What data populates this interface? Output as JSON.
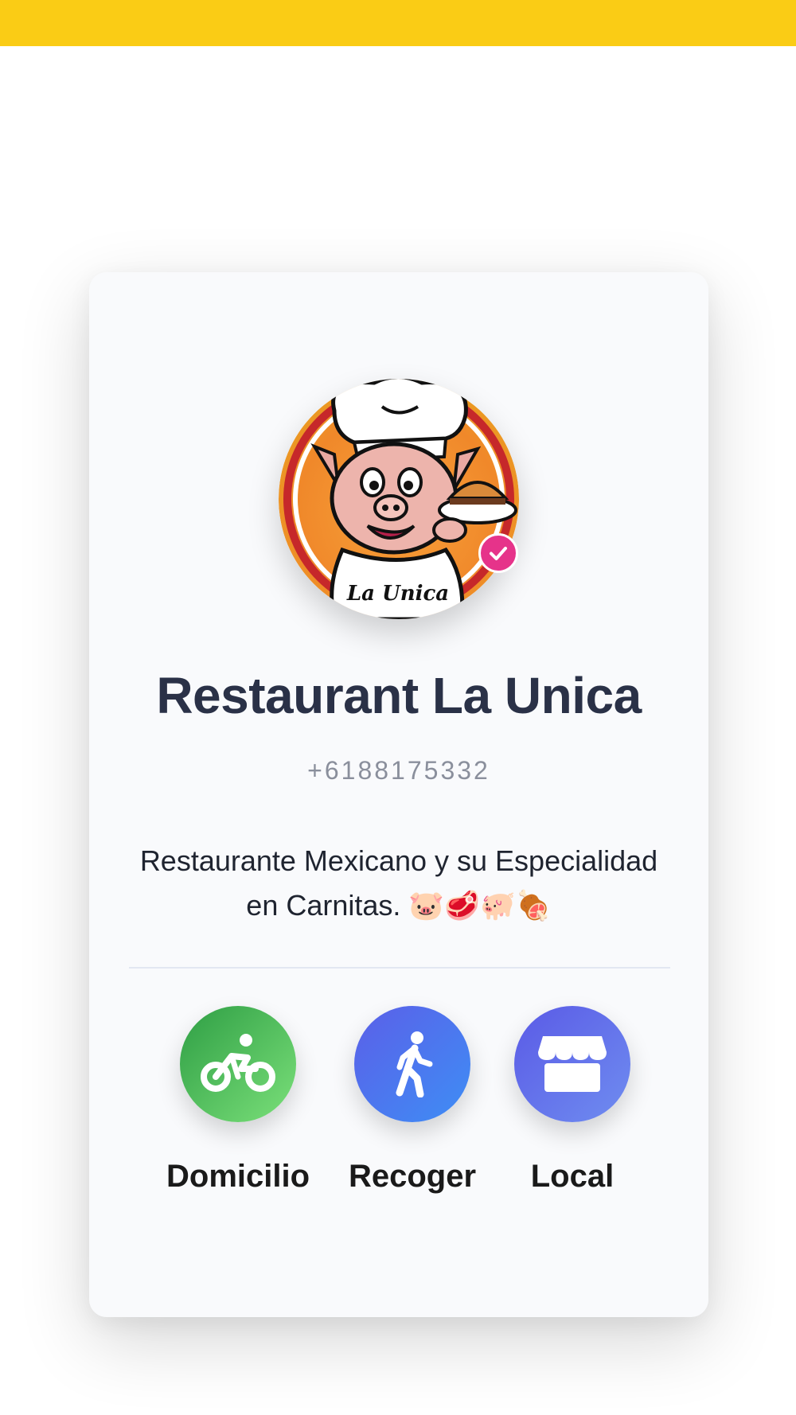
{
  "top_bar": {
    "color": "#FACC15"
  },
  "profile": {
    "name": "Restaurant La Unica",
    "phone": "+6188175332",
    "description": "Restaurante Mexicano y su Especialidad en Carnitas. 🐷🥩🐖🍖",
    "logo_text": "La Unica",
    "verified_badge": "check-icon"
  },
  "actions": [
    {
      "label": "Domicilio",
      "icon": "bicycle-icon",
      "color": "#4CC15A"
    },
    {
      "label": "Recoger",
      "icon": "walking-icon",
      "color": "#4F74EF"
    },
    {
      "label": "Local",
      "icon": "store-icon",
      "color": "#6675EA"
    }
  ],
  "colors": {
    "accent_pink": "#E6338A",
    "title": "#2A3147",
    "card_bg": "#F9FAFC"
  }
}
